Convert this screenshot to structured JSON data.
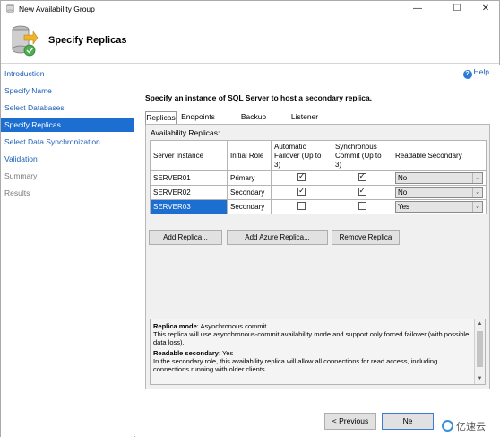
{
  "window": {
    "title": "New Availability Group",
    "controls": {
      "minimize": "—",
      "maximize": "☐",
      "close": "✕"
    }
  },
  "header": {
    "title": "Specify Replicas"
  },
  "sidebar": {
    "items": [
      {
        "label": "Introduction",
        "state": "link"
      },
      {
        "label": "Specify Name",
        "state": "link"
      },
      {
        "label": "Select Databases",
        "state": "link"
      },
      {
        "label": "Specify Replicas",
        "state": "active"
      },
      {
        "label": "Select Data Synchronization",
        "state": "link"
      },
      {
        "label": "Validation",
        "state": "link"
      },
      {
        "label": "Summary",
        "state": "disabled"
      },
      {
        "label": "Results",
        "state": "disabled"
      }
    ]
  },
  "main": {
    "help_label": "Help",
    "instruction": "Specify an instance of SQL Server to host a secondary replica.",
    "tabs": [
      {
        "label": "Replicas",
        "active": true
      },
      {
        "label": "Endpoints",
        "active": false
      },
      {
        "label": "Backup Preferences",
        "active": false
      },
      {
        "label": "Listener",
        "active": false
      }
    ],
    "availability_label": "Availability Replicas:",
    "grid": {
      "headers": [
        "Server Instance",
        "Initial Role",
        "Automatic Failover (Up to 3)",
        "Synchronous Commit (Up to 3)",
        "Readable Secondary"
      ],
      "rows": [
        {
          "server": "SERVER01",
          "role": "Primary",
          "auto_failover": true,
          "sync_commit": true,
          "readable": "No",
          "selected": false
        },
        {
          "server": "SERVER02",
          "role": "Secondary",
          "auto_failover": true,
          "sync_commit": true,
          "readable": "No",
          "selected": false
        },
        {
          "server": "SERVER03",
          "role": "Secondary",
          "auto_failover": false,
          "sync_commit": false,
          "readable": "Yes",
          "selected": true
        }
      ]
    },
    "buttons": {
      "add_replica": "Add Replica...",
      "add_azure_replica": "Add Azure Replica...",
      "remove_replica": "Remove Replica"
    },
    "info": {
      "replica_mode_label": "Replica mode",
      "replica_mode_value": ": Asynchronous commit",
      "replica_mode_desc": "This replica will use asynchronous-commit availability mode and support only forced failover (with possible data loss).",
      "readable_label": "Readable secondary",
      "readable_value": ": Yes",
      "readable_desc": "In the secondary role, this availability replica will allow all connections for read access, including connections running with older clients."
    }
  },
  "footer": {
    "previous": "< Previous",
    "next": "Ne"
  },
  "watermark": {
    "text": "亿速云"
  },
  "colors": {
    "accent": "#1c6fd0",
    "link": "#1a5fb4"
  }
}
